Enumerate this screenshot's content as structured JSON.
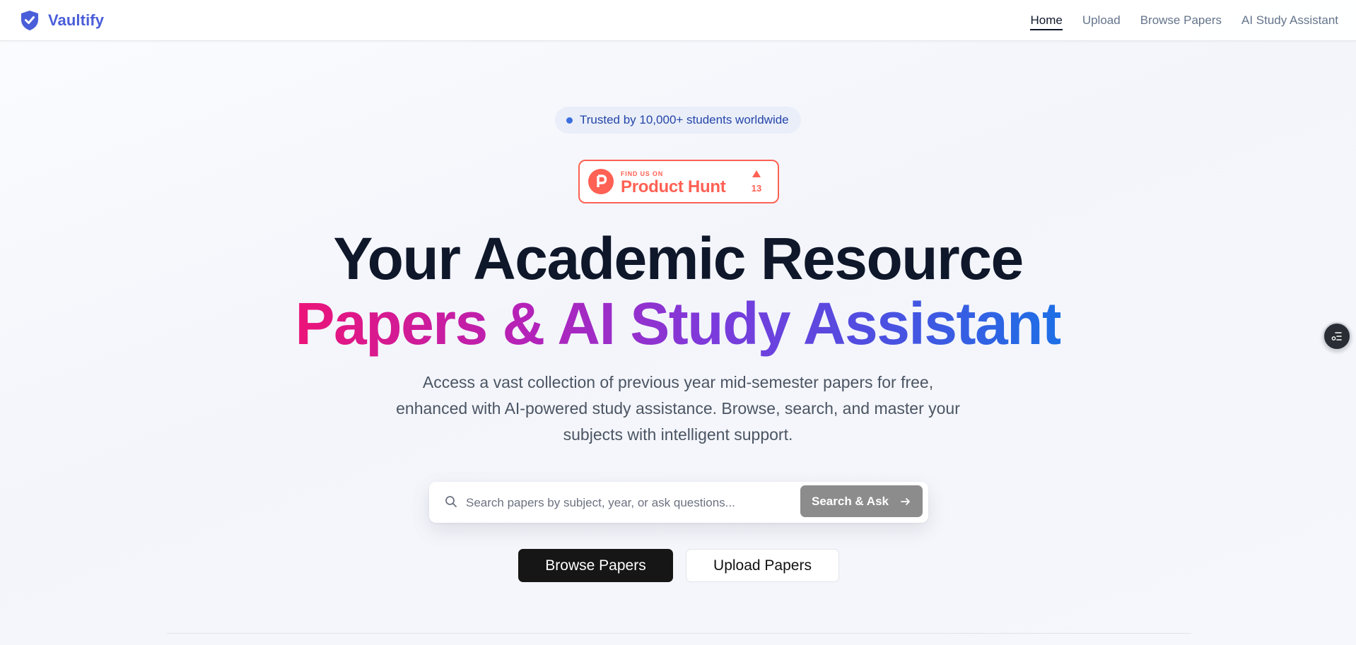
{
  "nav": {
    "brand": "Vaultify",
    "links": [
      {
        "label": "Home",
        "active": true
      },
      {
        "label": "Upload",
        "active": false
      },
      {
        "label": "Browse Papers",
        "active": false
      },
      {
        "label": "AI Study Assistant",
        "active": false
      }
    ]
  },
  "hero": {
    "badge_text": "Trusted by 10,000+ students worldwide",
    "product_hunt": {
      "find_us": "FIND US ON",
      "name": "Product Hunt",
      "upvotes": "13",
      "logo_letter": "P"
    },
    "headline_line1": "Your Academic Resource",
    "headline_line2": "Papers & AI Study Assistant",
    "description": "Access a vast collection of previous year mid-semester papers for free, enhanced with AI-powered study assistance. Browse, search, and master your subjects with intelligent support."
  },
  "search": {
    "placeholder": "Search papers by subject, year, or ask questions...",
    "value": "",
    "button_label": "Search & Ask"
  },
  "cta": {
    "browse_label": "Browse Papers",
    "upload_label": "Upload Papers"
  },
  "icons": {
    "brand": "shield-check-icon",
    "search": "search-icon",
    "arrow": "arrow-right-icon",
    "floating": "list-filter-icon"
  },
  "colors": {
    "brand": "#4a5ed9",
    "product_hunt": "#ff6154",
    "gradient": [
      "#ec1478",
      "#b522b8",
      "#7b3bdc",
      "#4f4ee0",
      "#1d6fe6"
    ],
    "search_button": "#8c8c8c",
    "primary_button": "#161616"
  }
}
